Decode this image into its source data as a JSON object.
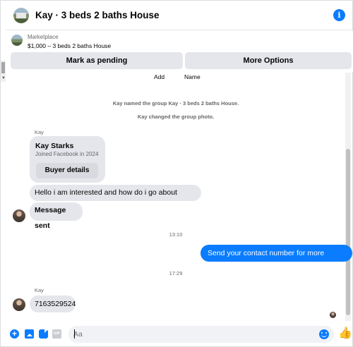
{
  "header": {
    "title": "Kay · 3 beds 2 baths House",
    "info_icon": "i"
  },
  "marketplace": {
    "label": "Marketplace",
    "price_title": "$1,000 – 3 beds 2 baths House",
    "mark_pending": "Mark as pending",
    "more_options": "More Options"
  },
  "chat": {
    "add_label": "Add",
    "name_label": "Name",
    "system_messages": [
      "Kay named the group Kay · 3 beds 2 baths House.",
      "Kay changed the group photo."
    ],
    "sender_name": "Kay",
    "profile_card": {
      "name": "Kay Starks",
      "subtitle": "Joined Facebook in 2024",
      "button": "Buyer details"
    },
    "messages": [
      {
        "from": "Kay",
        "text": "Hello i am interested and how do i go about applying?"
      },
      {
        "from": "Kay",
        "text": "Message sent"
      },
      {
        "timestamp": "13:10"
      },
      {
        "from": "me",
        "text": "Send your contact number for more details."
      },
      {
        "timestamp": "17:29"
      },
      {
        "from": "Kay",
        "text": "7163529524"
      }
    ],
    "sender_name_2": "Kay"
  },
  "composer": {
    "placeholder": "Aa",
    "gif_label": "GIF",
    "plus_icon": "+",
    "like_icon": "👍"
  },
  "colors": {
    "accent": "#0a7cff",
    "bubble_in": "#e4e6eb",
    "muted_text": "#65676b"
  }
}
